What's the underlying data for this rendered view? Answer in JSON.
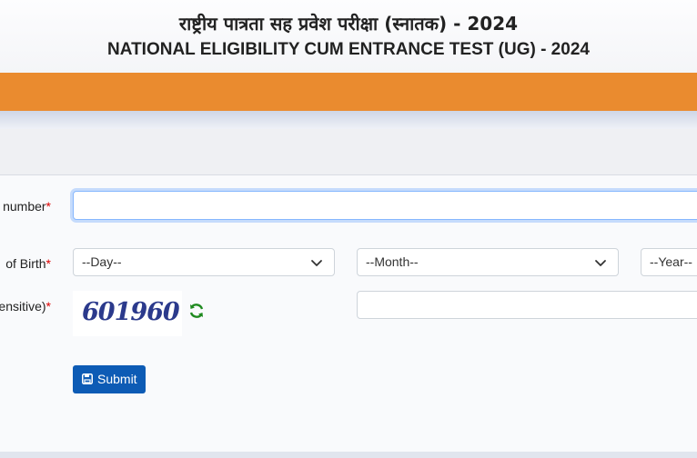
{
  "header": {
    "title_hi": "राष्ट्रीय पात्रता सह प्रवेश परीक्षा (स्नातक) - 2024",
    "title_en": "NATIONAL ELIGIBILITY CUM ENTRANCE TEST (UG) - 2024"
  },
  "form": {
    "application_label": "number",
    "dob_label": "of Birth",
    "captcha_label": "ensitive)",
    "required_mark": "*",
    "application_value": "",
    "day_select": "--Day--",
    "month_select": "--Month--",
    "year_select": "--Year--",
    "captcha_code": "601960",
    "captcha_input_value": "",
    "submit_label": "Submit"
  },
  "colors": {
    "orange_bar": "#ea8b2f",
    "submit_bg": "#0d5bb5",
    "required": "#dd0000",
    "refresh_icon": "#1f8a1f"
  },
  "icons": {
    "select_arrow": "chevron-down-icon",
    "refresh": "refresh-icon",
    "submit": "save-icon"
  }
}
